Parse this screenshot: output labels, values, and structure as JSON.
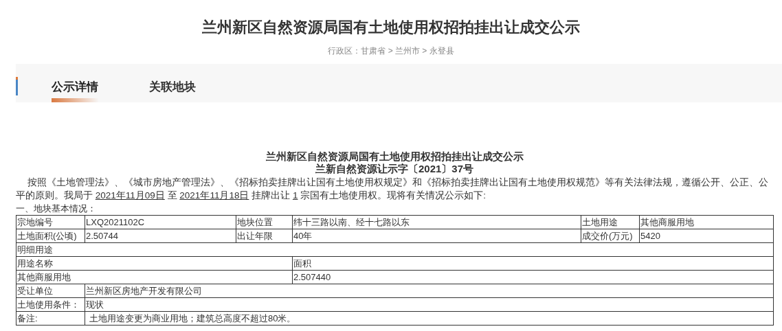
{
  "header": {
    "title": "兰州新区自然资源局国有土地使用权招拍挂出让成交公示",
    "breadcrumb": "行政区：甘肃省 > 兰州市 > 永登县"
  },
  "tabs": [
    {
      "label": "公示详情",
      "selected": true
    },
    {
      "label": "关联地块",
      "selected": false
    }
  ],
  "notice": {
    "title": "兰州新区自然资源局国有土地使用权招拍挂出让成交公示",
    "number": "兰新自然资源让示字〔2021〕37号",
    "paragraph": [
      {
        "text": "按照《土地管理法》、《城市房地产管理法》、《招标拍卖挂牌出让国有土地使用权规定》和《招标拍卖挂牌出让国有土地使用权规范》等有关法律法规，遵循公开、公正、公平的原则。我局于 ",
        "underlined": false
      },
      {
        "text": "2021年11月09日",
        "underlined": true
      },
      {
        "text": " 至 ",
        "underlined": false
      },
      {
        "text": "2021年11月18日",
        "underlined": true
      },
      {
        "text": " 挂牌出让 ",
        "underlined": false
      },
      {
        "text": "1",
        "underlined": true
      },
      {
        "text": " 宗国有土地使用权。现将有关情况公示如下:",
        "underlined": false
      }
    ],
    "section": "一、地块基本情况：",
    "table": [
      {
        "kind": "pairs",
        "cells": [
          "宗地编号",
          "LXQ2021102C",
          "地块位置",
          "纬十三路以南、经十七路以东",
          "土地用途",
          "其他商服用地"
        ]
      },
      {
        "kind": "pairs",
        "cells": [
          "土地面积(公顷)",
          "2.50744",
          "出让年限",
          "40年",
          "成交价(万元)",
          "5420"
        ]
      },
      {
        "kind": "full",
        "cells": [
          "明细用途"
        ]
      },
      {
        "kind": "halves",
        "cells": [
          "用途名称",
          "面积"
        ]
      },
      {
        "kind": "halves",
        "cells": [
          "其他商服用地",
          "2.507440"
        ]
      },
      {
        "kind": "label_value",
        "cells": [
          "受让单位",
          "兰州新区房地产开发有限公司"
        ]
      },
      {
        "kind": "label_value",
        "cells": [
          "土地使用条件：",
          "现状"
        ]
      },
      {
        "kind": "label_value",
        "cells": [
          "备注:",
          "土地用途变更为商业用地；建筑总高度不超过80米。"
        ]
      }
    ]
  }
}
